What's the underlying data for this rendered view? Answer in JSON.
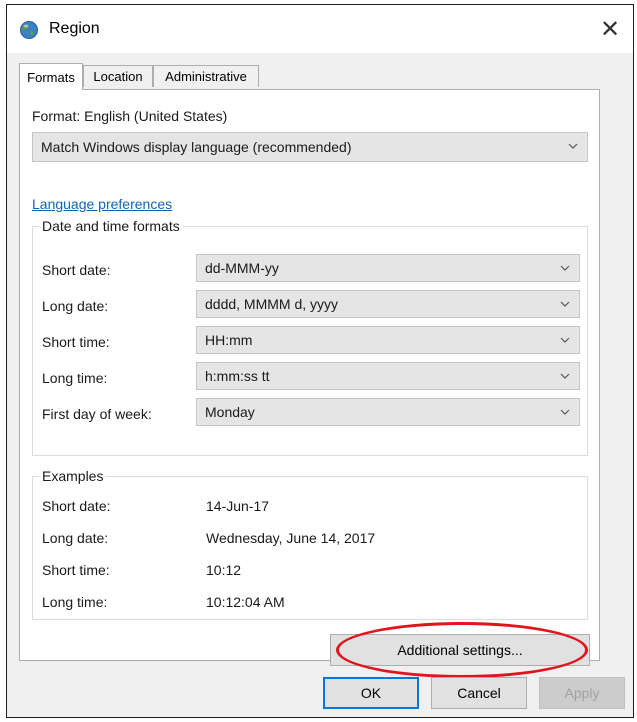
{
  "window": {
    "title": "Region",
    "close_glyph": "✕"
  },
  "tabs": [
    {
      "label": "Formats",
      "active": true
    },
    {
      "label": "Location",
      "active": false
    },
    {
      "label": "Administrative",
      "active": false
    }
  ],
  "format": {
    "label": "Format: English (United States)",
    "selected": "Match Windows display language (recommended)"
  },
  "language_link": "Language preferences",
  "date_time": {
    "legend": "Date and time formats",
    "rows": [
      {
        "label": "Short date:",
        "value": "dd-MMM-yy"
      },
      {
        "label": "Long date:",
        "value": "dddd, MMMM d, yyyy"
      },
      {
        "label": "Short time:",
        "value": "HH:mm"
      },
      {
        "label": "Long time:",
        "value": "h:mm:ss tt"
      },
      {
        "label": "First day of week:",
        "value": "Monday"
      }
    ]
  },
  "examples": {
    "legend": "Examples",
    "rows": [
      {
        "label": "Short date:",
        "value": "14-Jun-17"
      },
      {
        "label": "Long date:",
        "value": "Wednesday, June 14, 2017"
      },
      {
        "label": "Short time:",
        "value": "10:12"
      },
      {
        "label": "Long time:",
        "value": "10:12:04 AM"
      }
    ]
  },
  "buttons": {
    "additional": "Additional settings...",
    "ok": "OK",
    "cancel": "Cancel",
    "apply": "Apply"
  },
  "colors": {
    "link": "#1464b4",
    "highlight_ring": "#e0141a",
    "default_button_border": "#0078d7"
  },
  "icons": {
    "title": "globe-icon",
    "dropdown": "chevron-down-icon"
  }
}
